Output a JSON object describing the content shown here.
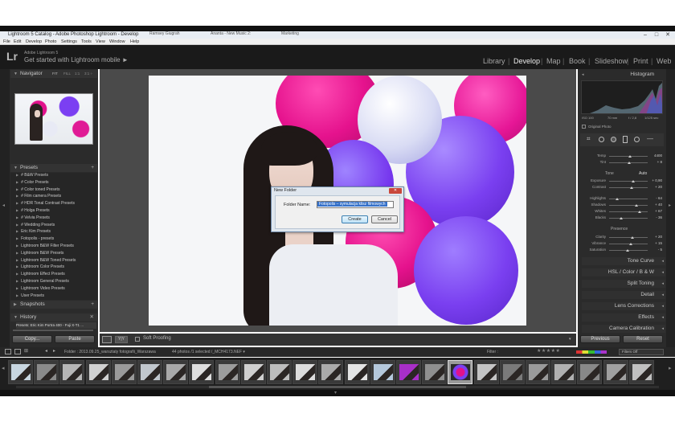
{
  "window": {
    "title": "Lightroom 5 Catalog - Adobe Photoshop Lightroom - Develop",
    "tabs": [
      "Ramsey Giugrah",
      "Ananta - New Music 2:",
      "Marketing"
    ]
  },
  "menu": [
    "File",
    "Edit",
    "Develop",
    "Photo",
    "Settings",
    "Tools",
    "View",
    "Window",
    "Help"
  ],
  "header": {
    "logo": "Lr",
    "subtitle": "Adobe Lightroom 5",
    "tagline": "Get started with Lightroom mobile ►",
    "modules": [
      "Library",
      "Develop",
      "Map",
      "Book",
      "Slideshow",
      "Print",
      "Web"
    ],
    "active_module": "Develop"
  },
  "left": {
    "navigator": "Navigator",
    "nav_zoom": [
      "FIT",
      "FILL",
      "1:1",
      "3:1 ÷"
    ],
    "presets_title": "Presets",
    "presets": [
      "# B&W Presets",
      "# Color Presets",
      "# Color toned Presets",
      "# Film camera Presets",
      "# HDR Tonal Contrast Presets",
      "# Holga Presets",
      "# Velvia Presets",
      "# Wedding Presets",
      "Eric Kim Presets",
      "Fotopolis - presets",
      "Lightroom B&W Filter Presets",
      "Lightroom B&W Presets",
      "Lightroom B&W Toned Presets",
      "Lightroom Color Presets",
      "Lightroom Effect Presets",
      "Lightroom General Presets",
      "Lightroom Video Presets",
      "User Presets"
    ],
    "snapshots": "Snapshots",
    "history": "History",
    "history_item": "Presets: Eric Kim Portra 400 - Fuji X-T1 ...",
    "copy": "Copy...",
    "paste": "Paste"
  },
  "toolbar": {
    "soft_proofing": "Soft Proofing"
  },
  "dialog": {
    "title": "New Folder",
    "label": "Folder Name:",
    "value": "Fotopolis – symulacja klisz filmowych",
    "create": "Create",
    "cancel": "Cancel",
    "close": "✕"
  },
  "right": {
    "histogram": "Histogram",
    "histo_info": [
      "ISO 100",
      "70 mm",
      "f / 2,8",
      "1/125 sec"
    ],
    "original_photo": "Original Photo",
    "basic": {
      "wb_rows": [
        {
          "label": "Temp",
          "value": "4400"
        },
        {
          "label": "Tint",
          "value": "+ 8"
        }
      ],
      "tone_label": "Tone",
      "auto": "Auto",
      "tone_rows": [
        {
          "label": "Exposure",
          "value": "+ 0,90"
        },
        {
          "label": "Contrast",
          "value": "+ 20"
        }
      ],
      "light_rows": [
        {
          "label": "Highlights",
          "value": "- 64"
        },
        {
          "label": "Shadows",
          "value": "+ 40"
        },
        {
          "label": "Whites",
          "value": "+ 67"
        },
        {
          "label": "Blacks",
          "value": "- 36"
        }
      ],
      "presence": "Presence",
      "presence_rows": [
        {
          "label": "Clarity",
          "value": "+ 20"
        },
        {
          "label": "Vibrance",
          "value": "+ 15"
        },
        {
          "label": "Saturation",
          "value": "- 5"
        }
      ]
    },
    "sections": [
      "Tone Curve",
      "HSL / Color / B & W",
      "Split Toning",
      "Detail",
      "Lens Corrections",
      "Effects",
      "Camera Calibration"
    ],
    "previous": "Previous",
    "reset": "Reset"
  },
  "filmstrip": {
    "path": "Folder : 2013.09.25_warsztaty fotografii_Warszawa",
    "count": "44 photos /1 selected /_MCH4173.NEF ▾",
    "filter": "Filter :",
    "filter_value": "Filters Off"
  },
  "colors": {
    "balloon_magenta": "#e5128d",
    "balloon_purple": "#7a3ff0",
    "balloon_white": "#e9ebf6",
    "dialog_select": "#3470c9"
  }
}
